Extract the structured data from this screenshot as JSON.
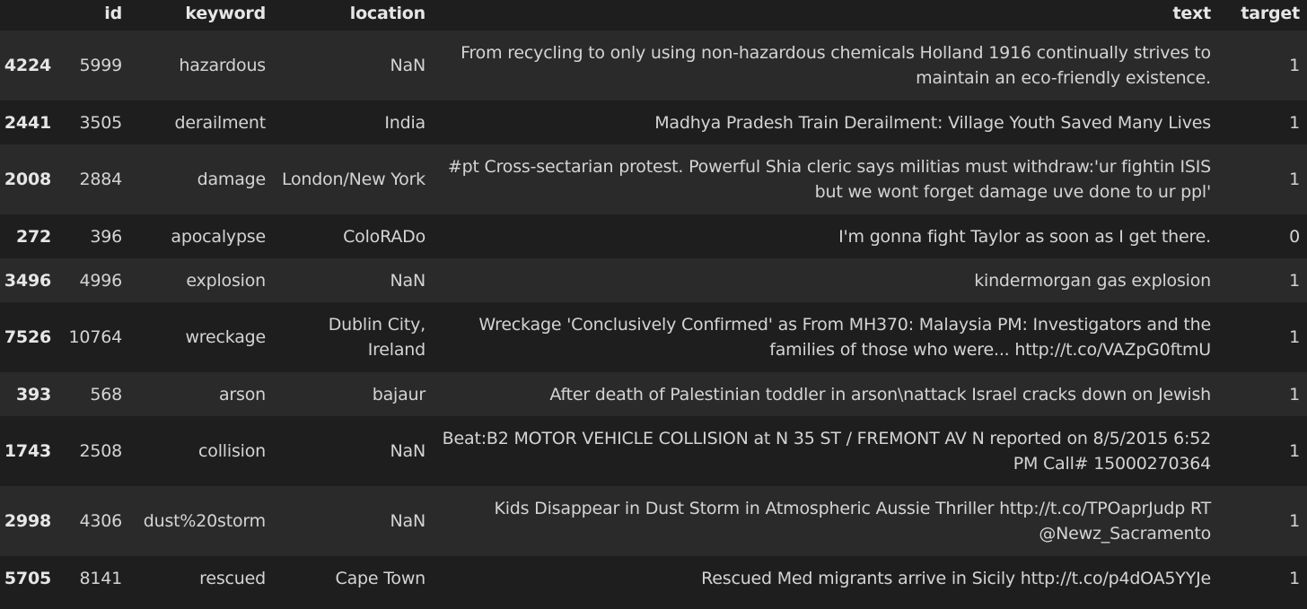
{
  "table": {
    "columns": [
      "",
      "id",
      "keyword",
      "location",
      "text",
      "target"
    ],
    "rows": [
      {
        "index": "4224",
        "id": "5999",
        "keyword": "hazardous",
        "location": "NaN",
        "text": "From recycling to only using non-hazardous chemicals Holland 1916 continually strives to maintain an eco-friendly existence.",
        "target": "1"
      },
      {
        "index": "2441",
        "id": "3505",
        "keyword": "derailment",
        "location": "India",
        "text": "Madhya Pradesh Train Derailment: Village Youth Saved Many Lives",
        "target": "1"
      },
      {
        "index": "2008",
        "id": "2884",
        "keyword": "damage",
        "location": "London/New York",
        "text": "#pt Cross-sectarian protest. Powerful Shia cleric says militias must withdraw:'ur fightin ISIS but we wont forget damage uve done to ur ppl'",
        "target": "1"
      },
      {
        "index": "272",
        "id": "396",
        "keyword": "apocalypse",
        "location": "ColoRADo",
        "text": "I'm gonna fight Taylor as soon as I get there.",
        "target": "0"
      },
      {
        "index": "3496",
        "id": "4996",
        "keyword": "explosion",
        "location": "NaN",
        "text": "kindermorgan gas explosion",
        "target": "1"
      },
      {
        "index": "7526",
        "id": "10764",
        "keyword": "wreckage",
        "location": "Dublin City, Ireland",
        "text": "Wreckage 'Conclusively Confirmed' as From MH370: Malaysia PM: Investigators and the families of those who were... http://t.co/VAZpG0ftmU",
        "target": "1"
      },
      {
        "index": "393",
        "id": "568",
        "keyword": "arson",
        "location": "bajaur",
        "text": "After death of Palestinian toddler in arson\\nattack Israel cracks down on Jewish",
        "target": "1"
      },
      {
        "index": "1743",
        "id": "2508",
        "keyword": "collision",
        "location": "NaN",
        "text": "Beat:B2 MOTOR VEHICLE COLLISION at N 35 ST / FREMONT AV N reported on 8/5/2015 6:52 PM Call# 15000270364",
        "target": "1"
      },
      {
        "index": "2998",
        "id": "4306",
        "keyword": "dust%20storm",
        "location": "NaN",
        "text": "Kids Disappear in Dust Storm in Atmospheric Aussie Thriller http://t.co/TPOaprJudp RT @Newz_Sacramento",
        "target": "1"
      },
      {
        "index": "5705",
        "id": "8141",
        "keyword": "rescued",
        "location": "Cape Town",
        "text": "Rescued Med migrants arrive in Sicily http://t.co/p4dOA5YYJe",
        "target": "1"
      }
    ]
  }
}
